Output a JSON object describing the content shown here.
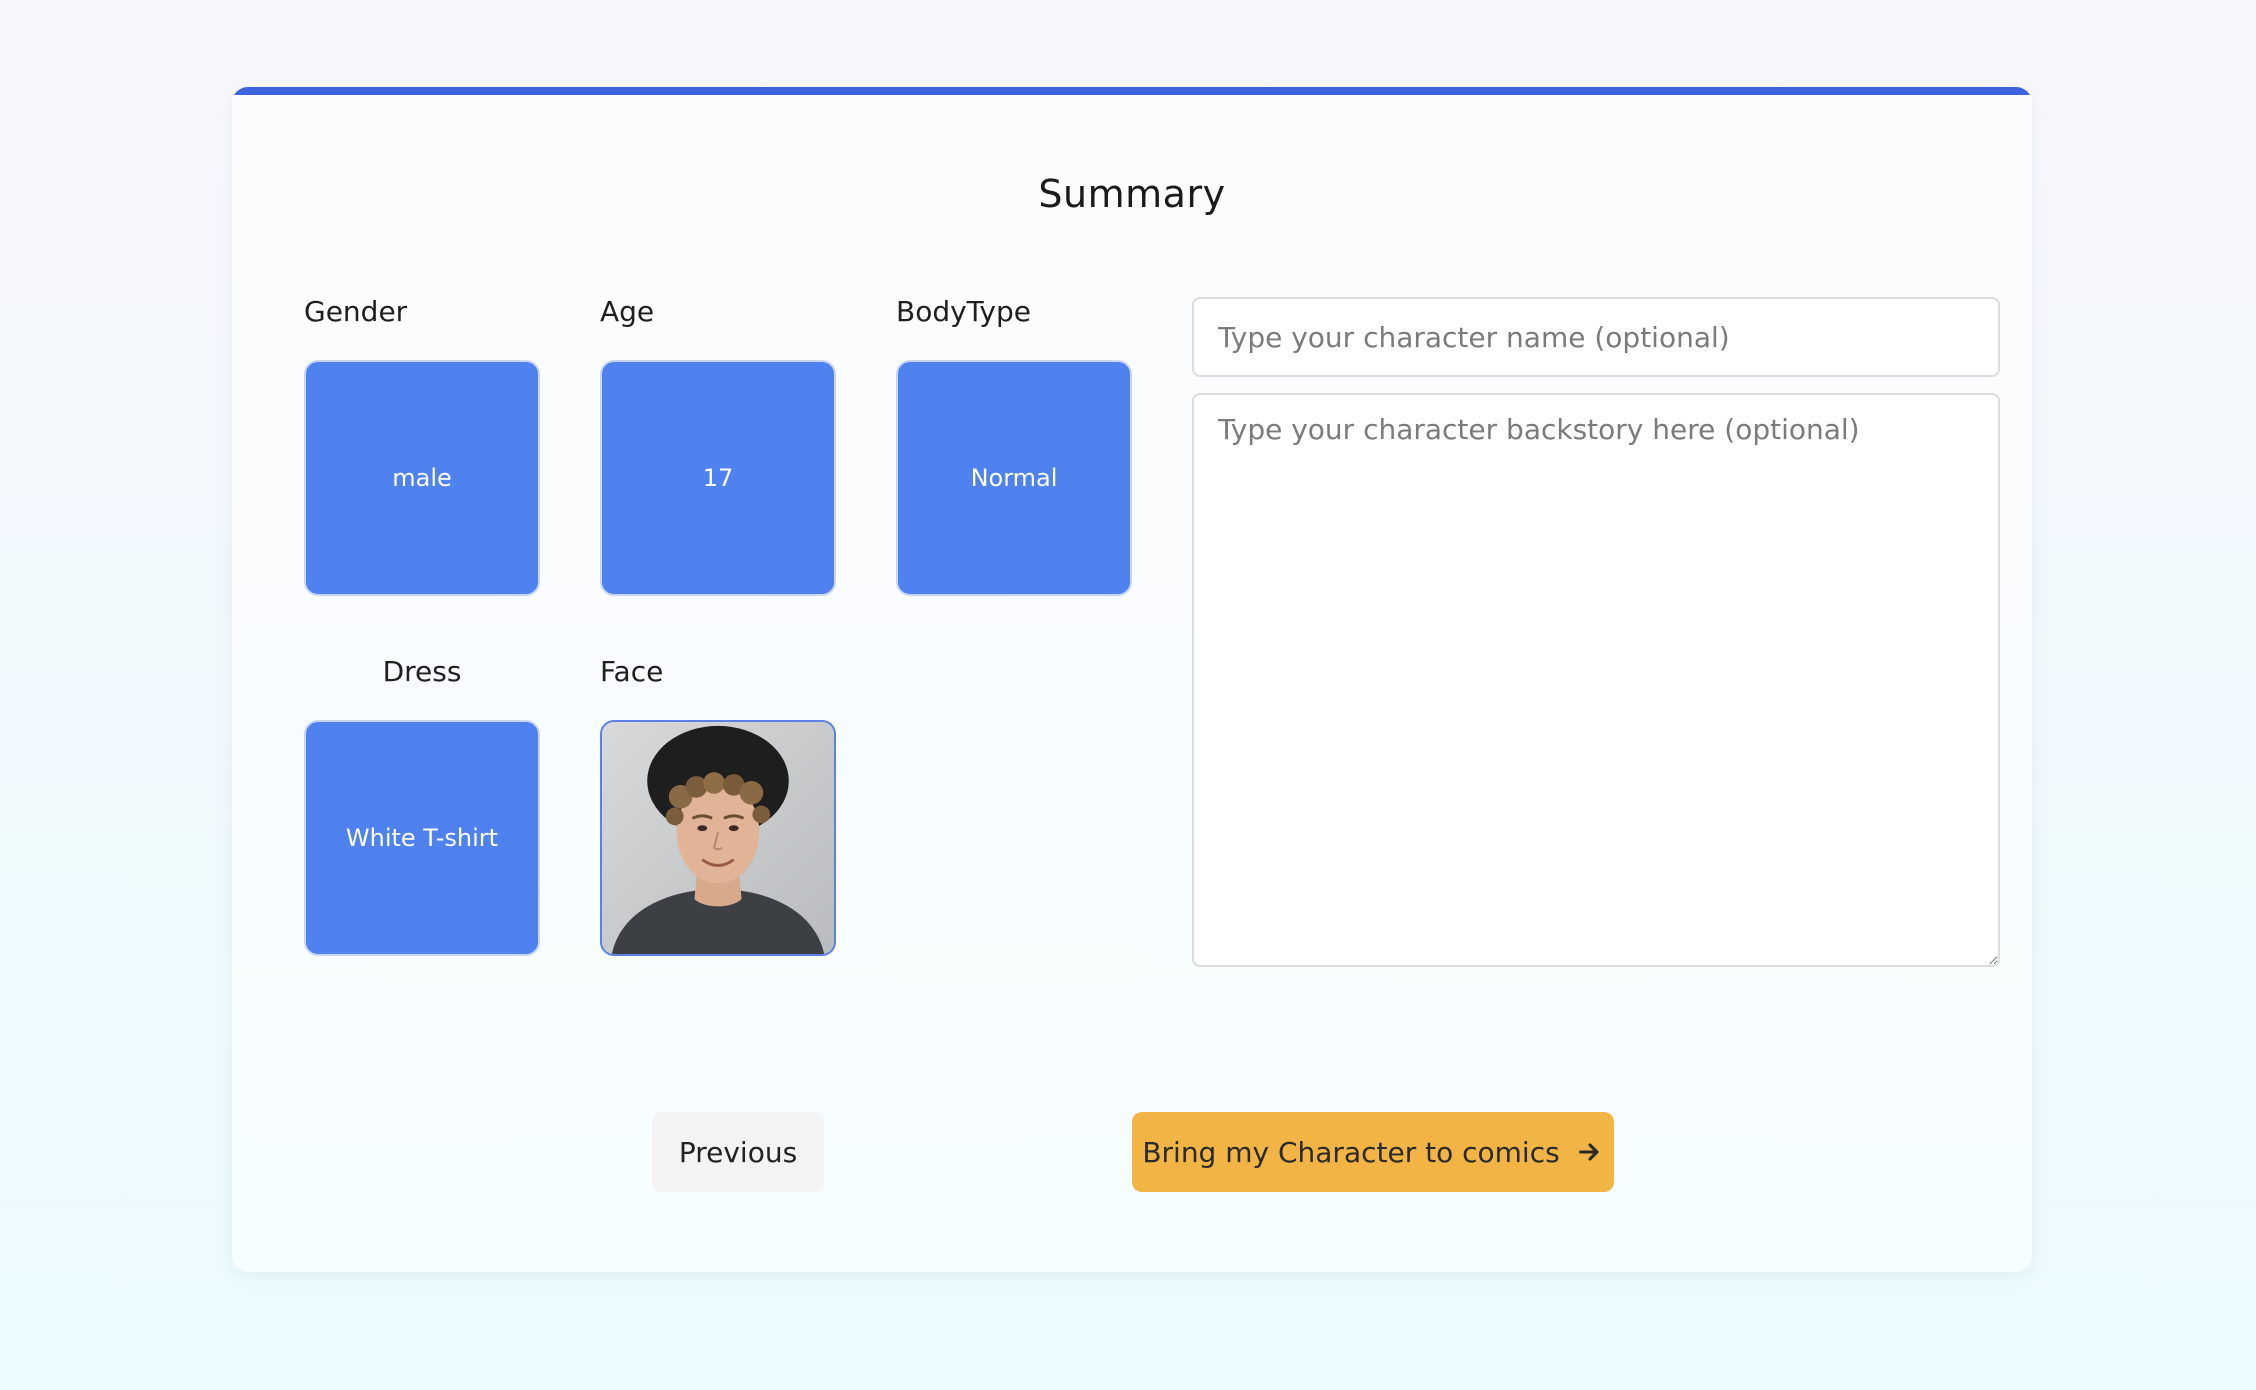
{
  "summary": {
    "title": "Summary"
  },
  "fields": {
    "gender": {
      "label": "Gender",
      "value": "male"
    },
    "age": {
      "label": "Age",
      "value": "17"
    },
    "body_type": {
      "label": "BodyType",
      "value": "Normal"
    },
    "dress": {
      "label": "Dress",
      "value": "White T-shirt"
    },
    "face": {
      "label": "Face"
    }
  },
  "form": {
    "name_placeholder": "Type your character name (optional)",
    "name_value": "",
    "backstory_placeholder": "Type your character backstory here (optional)",
    "backstory_value": ""
  },
  "actions": {
    "previous_label": "Previous",
    "submit_label": "Bring my Character to comics",
    "submit_icon": "arrow-right-icon"
  },
  "colors": {
    "accent_bar": "#3b63db",
    "tile": "#4f82ee",
    "primary_button": "#f2b444",
    "secondary_button": "#f3f3f4"
  }
}
